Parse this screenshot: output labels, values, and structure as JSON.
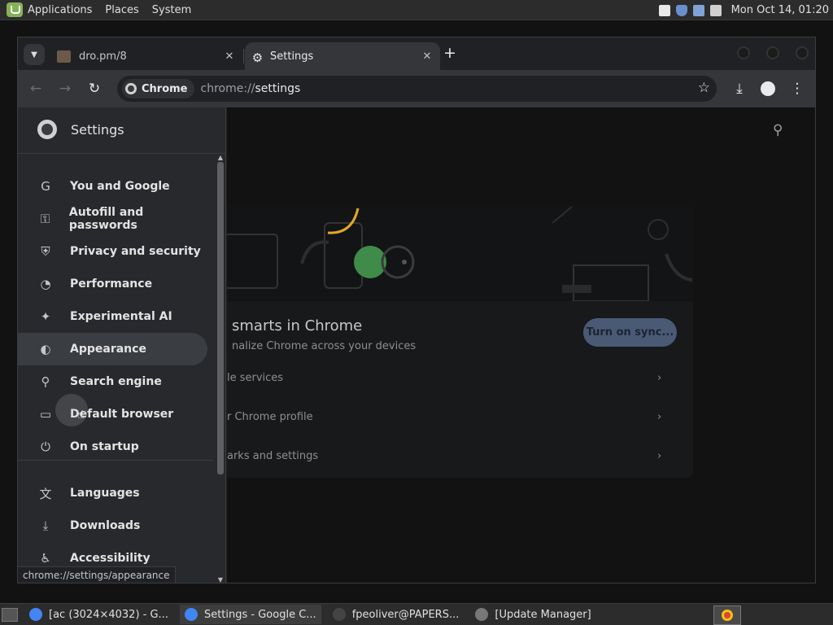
{
  "top_panel": {
    "menu": [
      "Applications",
      "Places",
      "System"
    ],
    "clock": "Mon Oct 14, 01:20"
  },
  "browser": {
    "tabs": [
      {
        "title": "dro.pm/8",
        "active": false
      },
      {
        "title": "Settings",
        "active": true
      }
    ],
    "chip_label": "Chrome",
    "url_scheme": "chrome://",
    "url_path": "settings",
    "status_url": "chrome://settings/appearance"
  },
  "sidebar": {
    "title": "Settings",
    "items": [
      {
        "label": "You and Google",
        "icon": "google-icon",
        "glyph": "G"
      },
      {
        "label": "Autofill and passwords",
        "icon": "key-icon",
        "glyph": "⚿"
      },
      {
        "label": "Privacy and security",
        "icon": "shield-icon",
        "glyph": "⛨"
      },
      {
        "label": "Performance",
        "icon": "speedometer-icon",
        "glyph": "◔"
      },
      {
        "label": "Experimental AI",
        "icon": "sparkle-icon",
        "glyph": "✦"
      },
      {
        "label": "Appearance",
        "icon": "palette-icon",
        "glyph": "◐",
        "active": true
      },
      {
        "label": "Search engine",
        "icon": "search-icon",
        "glyph": "⚲"
      },
      {
        "label": "Default browser",
        "icon": "browser-window-icon",
        "glyph": "▭"
      },
      {
        "label": "On startup",
        "icon": "power-icon",
        "glyph": "⏻"
      },
      {
        "label": "Languages",
        "icon": "translate-icon",
        "glyph": "文"
      },
      {
        "label": "Downloads",
        "icon": "download-icon",
        "glyph": "⤓"
      },
      {
        "label": "Accessibility",
        "icon": "accessibility-icon",
        "glyph": "♿"
      }
    ]
  },
  "main": {
    "card_title": "smarts in Chrome",
    "card_subtitle": "nalize Chrome across your devices",
    "sync_button": "Turn on sync...",
    "rows": [
      "le services",
      "r Chrome profile",
      "arks and settings"
    ],
    "row_arrow": "›"
  },
  "taskbar": {
    "tasks": [
      {
        "label": "[ac (3024×4032) - G...",
        "icon_color": "#4285f4"
      },
      {
        "label": "Settings - Google C...",
        "icon_color": "#4285f4",
        "active": true
      },
      {
        "label": "fpeoliver@PAPERS...",
        "icon_color": "#444444"
      },
      {
        "label": "[Update Manager]",
        "icon_color": "#777777"
      }
    ]
  },
  "colors": {
    "accent_sync": "#4a5a75",
    "mint_green": "#87b158",
    "illus_green": "#3f8b4a",
    "illus_yellow": "#e2a72a"
  }
}
